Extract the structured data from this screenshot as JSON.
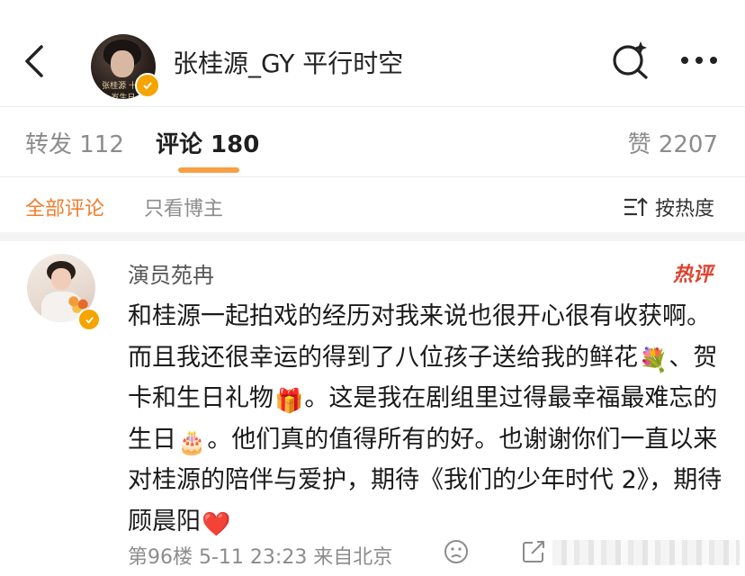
{
  "header": {
    "title": "张桂源_GY 平行时空",
    "avatar_subtext": "张桂源 十七岁生日"
  },
  "tabs": {
    "forward": "转发 112",
    "comments": "评论 180",
    "likes": "赞 2207"
  },
  "filters": {
    "all": "全部评论",
    "owner_only": "只看博主",
    "sort": "按热度"
  },
  "comment": {
    "username": "演员苑冉",
    "badge": "热评",
    "segments": [
      "和桂源一起拍戏的经历对我来说也很开心很有收获啊。而且我还很幸运的得到了八位孩子送给我的鲜花",
      "💐",
      "、贺卡和生日礼物",
      "🎁",
      "。这是我在剧组里过得最幸福最难忘的生日",
      "🎂",
      "。他们真的值得所有的好。也谢谢你们一直以来对桂源的陪伴与爱护，期待《我们的少年时代 2》，期待顾晨阳",
      "❤️"
    ],
    "meta": "第96楼 5-11 23:23 来自北京"
  },
  "colors": {
    "accent": "#f07e2d",
    "tab_underline": "#f7a043",
    "hot": "#e0412e",
    "verified": "#f6a400"
  },
  "icons": [
    "back-arrow-icon",
    "search-sparkle-icon",
    "more-icon",
    "sort-icon",
    "face-icon",
    "share-icon",
    "verified-icon"
  ]
}
